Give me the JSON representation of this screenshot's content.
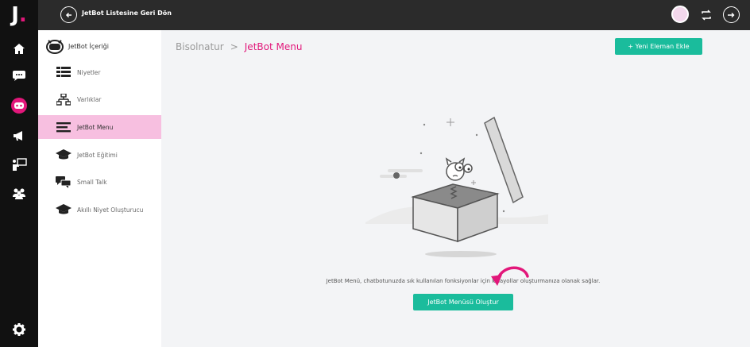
{
  "topbar": {
    "logo_letter": "J",
    "logo_dot": ".",
    "back_label": "JetBot Listesine Geri Dön"
  },
  "rail": {
    "items": [
      {
        "icon": "home-icon"
      },
      {
        "icon": "chat-icon"
      },
      {
        "icon": "bot-icon",
        "active_color": "#e2177a"
      },
      {
        "icon": "megaphone-icon"
      },
      {
        "icon": "presenter-icon"
      },
      {
        "icon": "users-icon"
      },
      {
        "icon": "settings-icon"
      }
    ]
  },
  "sidebar": {
    "header": "JetBot İçeriği",
    "items": [
      {
        "label": "Niyetler",
        "icon": "list-icon"
      },
      {
        "label": "Varlıklar",
        "icon": "hierarchy-icon"
      },
      {
        "label": "JetBot Menu",
        "icon": "menu-icon",
        "active": true
      },
      {
        "label": "JetBot Eğitimi",
        "icon": "graduation-cap-icon"
      },
      {
        "label": "Small Talk",
        "icon": "chat-bubbles-icon"
      },
      {
        "label": "Akıllı Niyet Oluşturucu",
        "icon": "graduation-cap-icon"
      }
    ]
  },
  "main": {
    "breadcrumb_root": "Bisolnatur",
    "breadcrumb_sep": ">",
    "breadcrumb_current": "JetBot Menu",
    "add_button": "+ Yeni Eleman Ekle",
    "description": "JetBot Menü, chatbotunuzda sık kullanılan fonksiyonlar için kısayollar oluşturmanıza olanak sağlar.",
    "create_button": "JetBot Menüsü Oluştur"
  },
  "colors": {
    "accent": "#e2177a",
    "button": "#1abc9c",
    "active_item_bg": "#f7bfe0"
  }
}
